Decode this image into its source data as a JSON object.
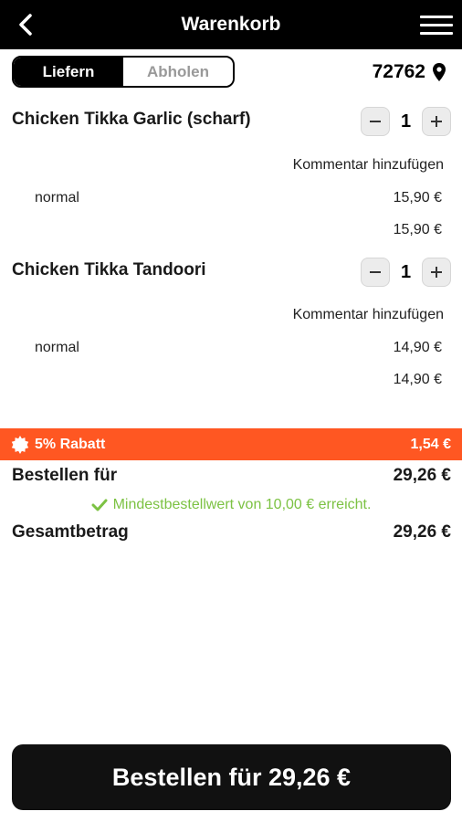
{
  "header": {
    "title": "Warenkorb",
    "back_icon": "back-arrow-icon",
    "menu_icon": "hamburger-menu-icon"
  },
  "delivery_mode": {
    "options": [
      "Liefern",
      "Abholen"
    ],
    "selected": "Liefern"
  },
  "location": {
    "postcode": "72762",
    "icon": "location-pin-icon"
  },
  "cart_items": [
    {
      "name": "Chicken Tikka Garlic (scharf)",
      "quantity": "1",
      "comment_label": "Kommentar hinzufügen",
      "variant": "normal",
      "variant_price": "15,90 €",
      "total_price": "15,90 €"
    },
    {
      "name": "Chicken Tikka Tandoori",
      "quantity": "1",
      "comment_label": "Kommentar hinzufügen",
      "variant": "normal",
      "variant_price": "14,90 €",
      "total_price": "14,90 €"
    }
  ],
  "discount": {
    "label": "5% Rabatt",
    "amount": "1,54 €",
    "icon": "discount-badge-icon",
    "color": "#ff5722"
  },
  "summary": {
    "order_for_label": "Bestellen für",
    "order_for_value": "29,26 €",
    "min_order_message": "Mindestbestellwert von 10,00 € erreicht.",
    "min_order_icon": "checkmark-icon",
    "min_order_color": "#7cc243",
    "total_label": "Gesamtbetrag",
    "total_value": "29,26 €"
  },
  "order_button": {
    "label": "Bestellen für 29,26 €"
  }
}
